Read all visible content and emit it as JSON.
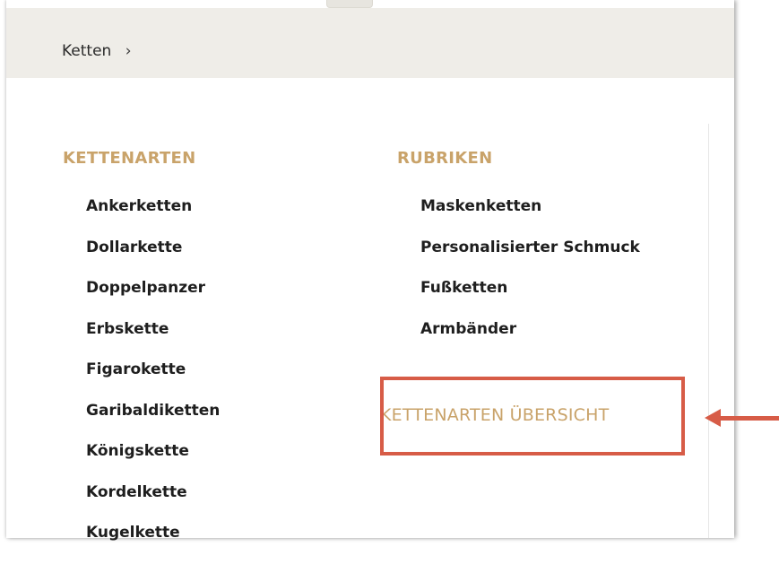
{
  "breadcrumb": {
    "label": "Ketten",
    "chevron": "›"
  },
  "left_column": {
    "heading": "KETTENARTEN",
    "items": [
      "Ankerketten",
      "Dollarkette",
      "Doppelpanzer",
      "Erbskette",
      "Figarokette",
      "Garibaldiketten",
      "Königskette",
      "Kordelkette",
      "Kugelkette"
    ]
  },
  "right_column": {
    "heading": "RUBRIKEN",
    "items": [
      "Maskenketten",
      "Personalisierter Schmuck",
      "Fußketten",
      "Armbänder"
    ]
  },
  "overview_link": {
    "label": "KETTENARTEN ÜBERSICHT"
  },
  "colors": {
    "accent_gold": "#c9a36a",
    "highlight_red": "#d75c47",
    "breadcrumb_bg": "#efede8"
  }
}
